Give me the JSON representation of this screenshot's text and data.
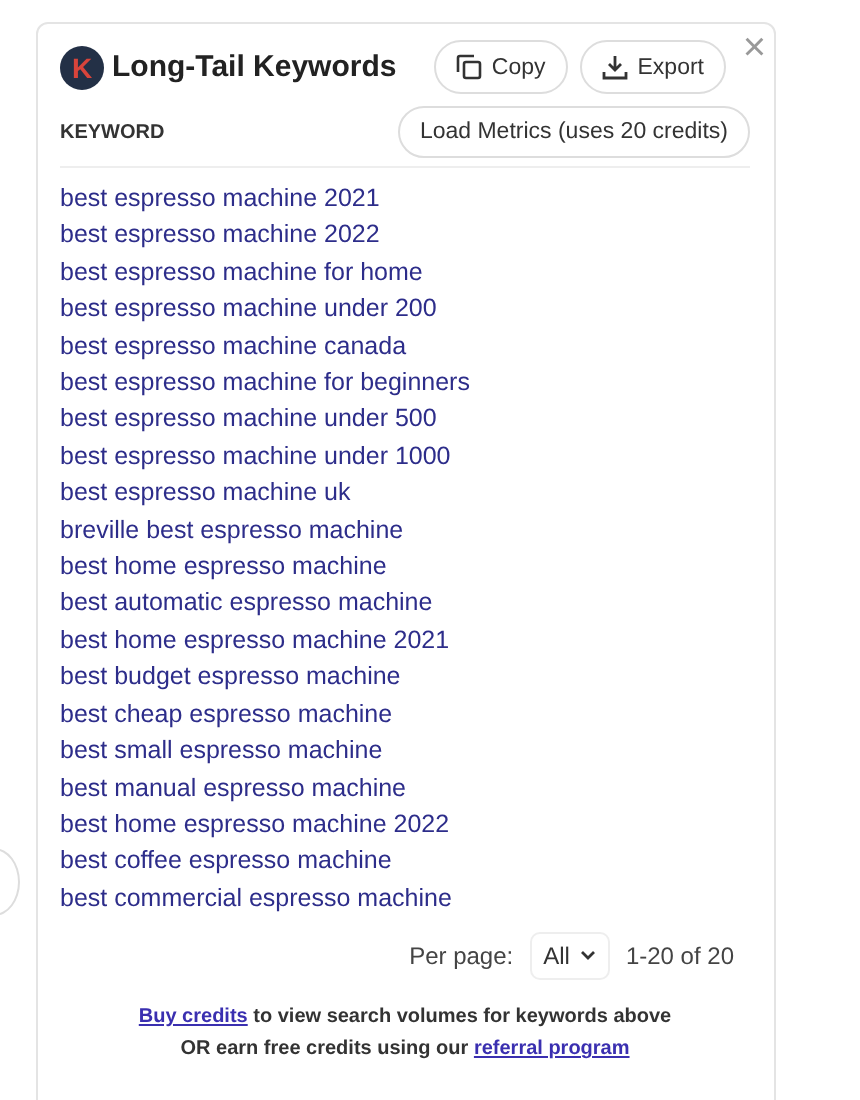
{
  "header": {
    "logo_letter": "K",
    "title": "Long-Tail Keywords",
    "buttons": [
      {
        "kind": "copy",
        "label": "Copy"
      },
      {
        "kind": "export",
        "label": "Export"
      }
    ],
    "close": "×"
  },
  "table": {
    "column": "KEYWORD",
    "load_button": "Load Metrics (uses 20 credits)",
    "rows": [
      "best espresso machine 2021",
      "best espresso machine 2022",
      "best espresso machine for home",
      "best espresso machine under 200",
      "best espresso machine canada",
      "best espresso machine for beginners",
      "best espresso machine under 500",
      "best espresso machine under 1000",
      "best espresso machine uk",
      "breville best espresso machine",
      "best home espresso machine",
      "best automatic espresso machine",
      "best home espresso machine 2021",
      "best budget espresso machine",
      "best cheap espresso machine",
      "best small espresso machine",
      "best manual espresso machine",
      "best home espresso machine 2022",
      "best coffee espresso machine",
      "best commercial espresso machine"
    ]
  },
  "pagination": {
    "label": "Per page:",
    "value": "All",
    "range": "1-20 of 20"
  },
  "footer": {
    "line_1": {
      "link": "Buy credits",
      "text": "to view search volumes for keywords above"
    },
    "line_2": {
      "text": "OR earn free credits using our",
      "link": "referral program"
    }
  }
}
